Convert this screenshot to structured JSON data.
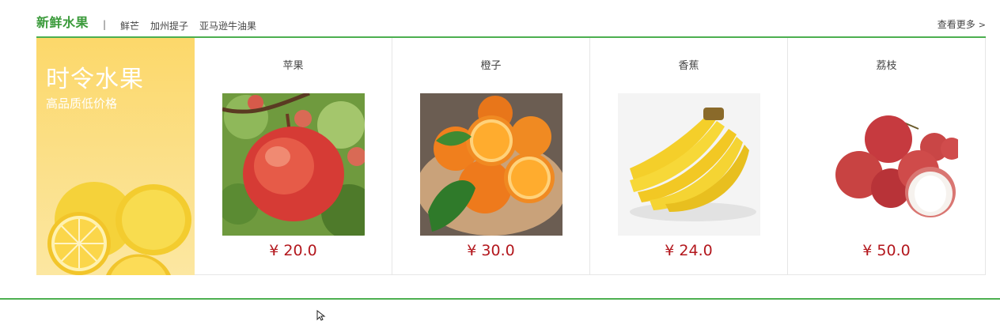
{
  "section": {
    "title": "新鲜水果",
    "separator": "|",
    "tags": [
      "鲜芒",
      "加州提子",
      "亚马逊牛油果"
    ],
    "more_label": "查看更多",
    "more_arrow": ">"
  },
  "promo": {
    "title": "时令水果",
    "subtitle": "高品质低价格"
  },
  "products": [
    {
      "name": "苹果",
      "price": "¥ 20.0"
    },
    {
      "name": "橙子",
      "price": "¥ 30.0"
    },
    {
      "name": "香蕉",
      "price": "¥ 24.0"
    },
    {
      "name": "荔枝",
      "price": "¥ 50.0"
    }
  ],
  "colors": {
    "accent_green": "#4caf50",
    "title_green": "#3a9a3a",
    "price_red": "#b3171d",
    "promo_yellow": "#fcd86a"
  }
}
